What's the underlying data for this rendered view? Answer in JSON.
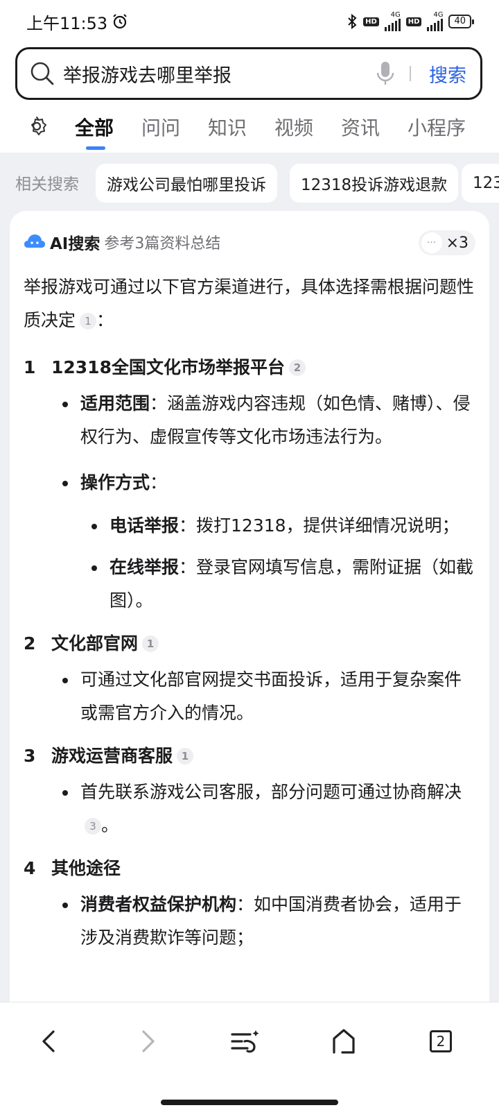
{
  "status_bar": {
    "time": "上午11:53",
    "battery": "40",
    "net1": "4G",
    "net2": "4G",
    "hd": "HD"
  },
  "search": {
    "query": "举报游戏去哪里举报",
    "button_label": "搜索"
  },
  "tabs": [
    {
      "label": "全部",
      "active": true
    },
    {
      "label": "问问"
    },
    {
      "label": "知识"
    },
    {
      "label": "视频"
    },
    {
      "label": "资讯"
    },
    {
      "label": "小程序"
    }
  ],
  "related": {
    "label": "相关搜索",
    "chips": [
      "游戏公司最怕哪里投诉",
      "12318投诉游戏退款",
      "123"
    ]
  },
  "ai": {
    "title": "AI搜索",
    "subtitle": "参考3篇资料总结",
    "more_count": "×3"
  },
  "answer": {
    "intro": "举报游戏可通过以下官方渠道进行，具体选择需根据问题性质决定",
    "intro_cite": "1",
    "sections": [
      {
        "num": "1",
        "title": "12318全国文化市场举报平台",
        "cite": "2",
        "scope_label": "适用范围",
        "scope_text": "：涵盖游戏内容违规（如色情、赌博）、侵权行为、虚假宣传等文化市场违法行为。",
        "method_label": "操作方式",
        "method_colon": "：",
        "phone_label": "电话举报",
        "phone_text": "：拨打12318，提供详细情况说明；",
        "online_label": "在线举报",
        "online_text": "：登录官网填写信息，需附证据（如截图）。"
      },
      {
        "num": "2",
        "title": "文化部官网",
        "cite": "1",
        "text": "可通过文化部官网提交书面投诉，适用于复杂案件或需官方介入的情况。"
      },
      {
        "num": "3",
        "title": "游戏运营商客服",
        "cite": "1",
        "text": "首先联系游戏公司客服，部分问题可通过协商解决",
        "text_cite": "3",
        "text_end": "。"
      },
      {
        "num": "4",
        "title": "其他途径",
        "consumer_label": "消费者权益保护机构",
        "consumer_text": "：如中国消费者协会，适用于涉及消费欺诈等问题；"
      }
    ]
  },
  "bottom_nav": {
    "tab_count": "2"
  }
}
